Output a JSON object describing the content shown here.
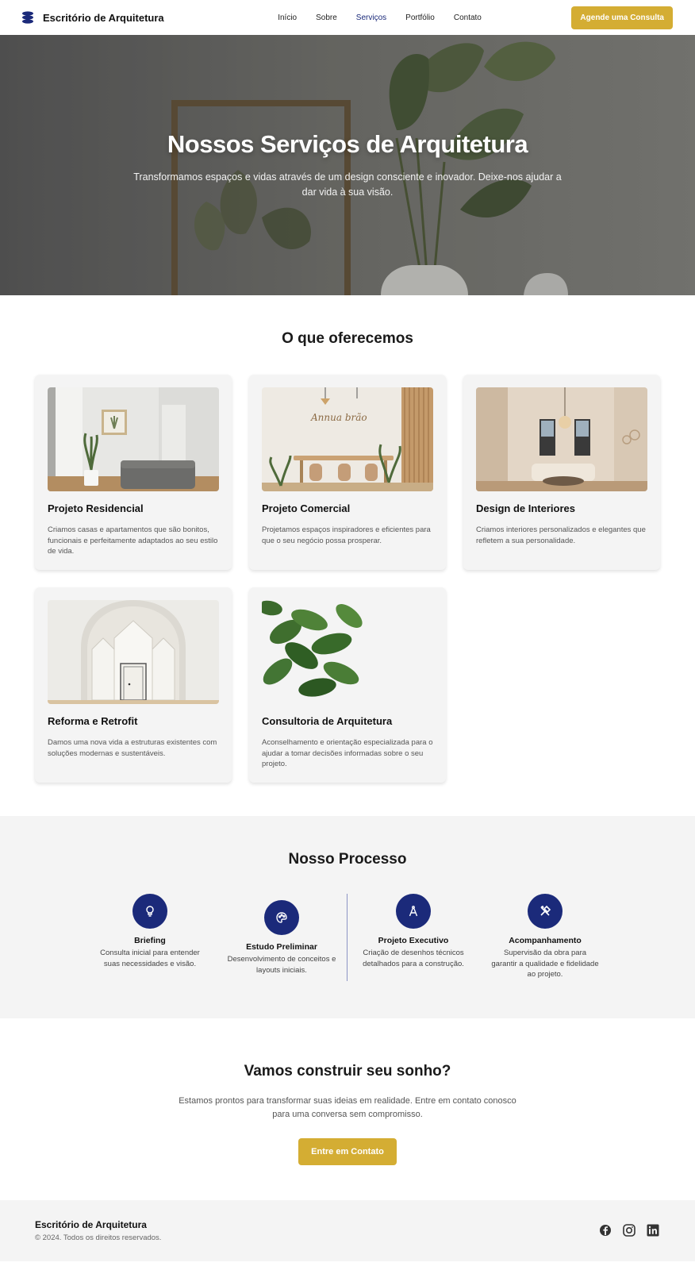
{
  "nav": {
    "brand": "Escritório de Arquitetura",
    "items": [
      {
        "label": "Início",
        "active": false
      },
      {
        "label": "Sobre",
        "active": false
      },
      {
        "label": "Serviços",
        "active": true
      },
      {
        "label": "Portfólio",
        "active": false
      },
      {
        "label": "Contato",
        "active": false
      }
    ],
    "cta": "Agende uma Consulta"
  },
  "hero": {
    "title": "Nossos Serviços de Arquitetura",
    "subtitle": "Transformamos espaços e vidas através de um design consciente e inovador. Deixe-nos ajudar a dar vida à sua visão."
  },
  "services": {
    "title": "O que oferecemos",
    "items": [
      {
        "title": "Projeto Residencial",
        "desc": "Criamos casas e apartamentos que são bonitos, funcionais e perfeitamente adaptados ao seu estilo de vida."
      },
      {
        "title": "Projeto Comercial",
        "desc": "Projetamos espaços inspiradores e eficientes para que o seu negócio possa prosperar.",
        "sign_text": "Annua brão"
      },
      {
        "title": "Design de Interiores",
        "desc": "Criamos interiores personalizados e elegantes que refletem a sua personalidade."
      },
      {
        "title": "Reforma e Retrofit",
        "desc": "Damos uma nova vida a estruturas existentes com soluções modernas e sustentáveis."
      },
      {
        "title": "Consultoria de Arquitetura",
        "desc": "Aconselhamento e orientação especializada para o ajudar a tomar decisões informadas sobre o seu projeto."
      }
    ]
  },
  "process": {
    "title": "Nosso Processo",
    "steps": [
      {
        "name": "Briefing",
        "desc": "Consulta inicial para entender suas necessidades e visão.",
        "icon": "lightbulb-icon"
      },
      {
        "name": "Estudo Preliminar",
        "desc": "Desenvolvimento de conceitos e layouts iniciais.",
        "icon": "palette-icon"
      },
      {
        "name": "Projeto Executivo",
        "desc": "Criação de desenhos técnicos detalhados para a construção.",
        "icon": "compass-icon"
      },
      {
        "name": "Acompanhamento",
        "desc": "Supervisão da obra para garantir a qualidade e fidelidade ao projeto.",
        "icon": "tools-icon"
      }
    ]
  },
  "cta": {
    "title": "Vamos construir seu sonho?",
    "text": "Estamos prontos para transformar suas ideias em realidade. Entre em contato conosco para uma conversa sem compromisso.",
    "button": "Entre em Contato"
  },
  "footer": {
    "name": "Escritório de Arquitetura",
    "copyright": "© 2024. Todos os direitos reservados.",
    "socials": [
      "facebook-icon",
      "instagram-icon",
      "linkedin-icon"
    ]
  },
  "colors": {
    "accent": "#d4ad33",
    "primary": "#1b2a7a",
    "section_bg": "#f4f4f4"
  }
}
